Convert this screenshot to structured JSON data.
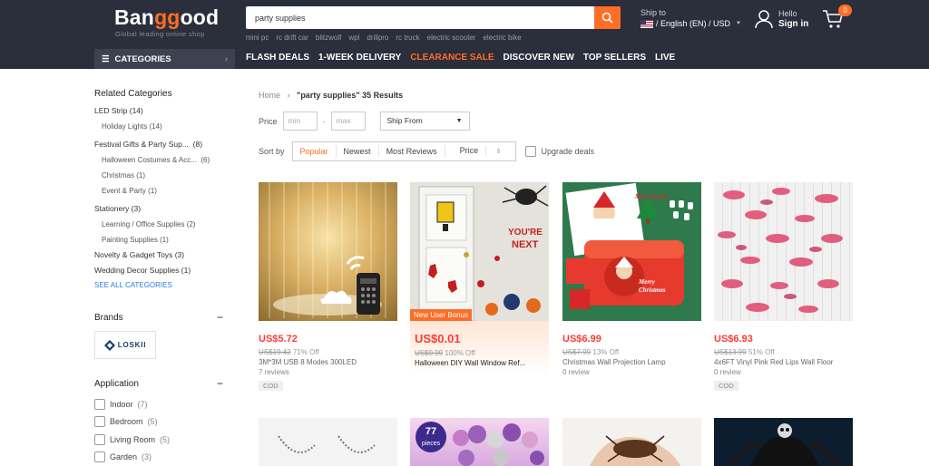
{
  "header": {
    "logo_prefix": "Ban",
    "logo_accent": "gg",
    "logo_suffix": "ood",
    "tagline": "Global leading online shop",
    "search_value": "party supplies",
    "hot_searches": [
      "mini pc",
      "rc drift car",
      "blitzwolf",
      "wpl",
      "drillpro",
      "rc truck",
      "electric scooter",
      "electric bike"
    ],
    "ship_to_label": "Ship to",
    "locale": "/ English (EN) / USD",
    "hello": "Hello",
    "sign_in": "Sign in",
    "cart_count": "0",
    "accent": "#ff6e26"
  },
  "nav": {
    "categories_label": "CATEGORIES",
    "items": [
      {
        "label": "FLASH DEALS",
        "highlight": false
      },
      {
        "label": "1-WEEK DELIVERY",
        "highlight": false
      },
      {
        "label": "CLEARANCE SALE",
        "highlight": true
      },
      {
        "label": "DISCOVER NEW",
        "highlight": false
      },
      {
        "label": "TOP SELLERS",
        "highlight": false
      },
      {
        "label": "LIVE",
        "highlight": false
      }
    ]
  },
  "sidebar": {
    "related_title": "Related Categories",
    "related": [
      {
        "label": "LED Strip",
        "count": "(14)",
        "sub": false
      },
      {
        "label": "Holiday Lights",
        "count": "(14)",
        "sub": true
      },
      {
        "label": "Festival Gifts & Party Sup...",
        "count": "(8)",
        "sub": false
      },
      {
        "label": "Halloween Costumes & Acc...",
        "count": "(6)",
        "sub": true
      },
      {
        "label": "Christmas",
        "count": "(1)",
        "sub": true
      },
      {
        "label": "Event & Party",
        "count": "(1)",
        "sub": true
      },
      {
        "label": "Stationery",
        "count": "(3)",
        "sub": false
      },
      {
        "label": "Learning / Office Supplies",
        "count": "(2)",
        "sub": true
      },
      {
        "label": "Painting Supplies",
        "count": "(1)",
        "sub": true
      },
      {
        "label": "Novelty & Gadget Toys",
        "count": "(3)",
        "sub": false
      },
      {
        "label": "Wedding Decor Supplies",
        "count": "(1)",
        "sub": false
      }
    ],
    "see_all": "SEE ALL CATEGORIES",
    "brands_title": "Brands",
    "brand_name": "LOSKII",
    "application_title": "Application",
    "applications": [
      {
        "label": "Indoor",
        "count": "(7)"
      },
      {
        "label": "Bedroom",
        "count": "(5)"
      },
      {
        "label": "Living Room",
        "count": "(5)"
      },
      {
        "label": "Garden",
        "count": "(3)"
      }
    ]
  },
  "results": {
    "home": "Home",
    "query": "\"party supplies\"",
    "count_text": "35 Results",
    "price_label": "Price",
    "min_placeholder": "min",
    "max_placeholder": "max",
    "ship_from": "Ship From",
    "sort_label": "Sort by",
    "sort_options": [
      "Popular",
      "Newest",
      "Most Reviews",
      "Price"
    ],
    "sort_active": "Popular",
    "upgrade_label": "Upgrade deals"
  },
  "products": [
    {
      "price": "US$5.72",
      "old": "US$19.42",
      "off": "71% Off",
      "title": "3M*3M USB 8 Modes 300LED",
      "reviews": "7 reviews",
      "cod": "COD",
      "tag": ""
    },
    {
      "price": "US$0.01",
      "old": "US$9.99",
      "off": "100% Off",
      "title": "Halloween DIY Wall Window Ref...",
      "reviews": "",
      "cod": "",
      "tag": "New User Bonus"
    },
    {
      "price": "US$6.99",
      "old": "US$7.99",
      "off": "13% Off",
      "title": "Christmas Wall Projection Lamp",
      "reviews": "0 review",
      "cod": "",
      "tag": ""
    },
    {
      "price": "US$6.93",
      "old": "US$13.99",
      "off": "51% Off",
      "title": "4x6FT Vinyl Pink Red Lips Wall Floor",
      "reviews": "0 review",
      "cod": "COD",
      "tag": ""
    }
  ],
  "second_row_badge": {
    "number": "77",
    "unit": "pieces"
  },
  "product_images": {
    "p1_text": "",
    "p2_sign": "YOU'RE NEXT",
    "p3_title": "Merry Xmas",
    "p3_sub": "Merry Christmas"
  }
}
